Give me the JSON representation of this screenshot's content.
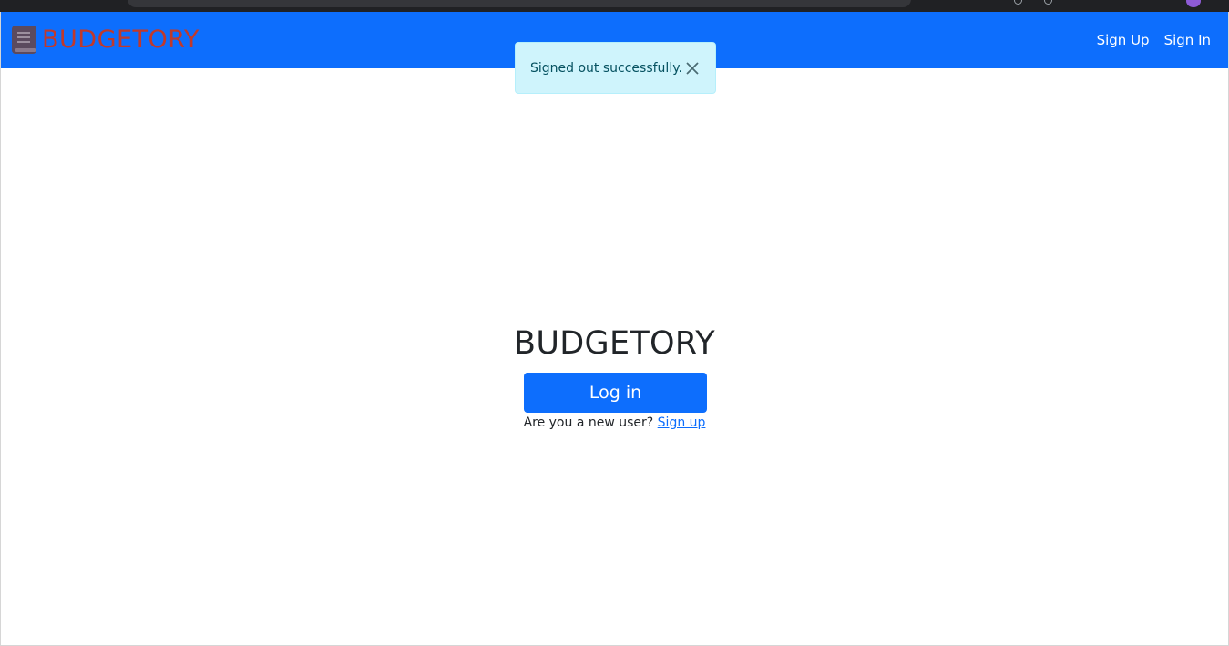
{
  "brand": {
    "name": "BUDGETORY",
    "icon": "book-icon",
    "text_color": "#c0392b",
    "icon_color": "#5b4a5e"
  },
  "navbar": {
    "background": "#0d6efd",
    "links": [
      {
        "label": "Sign Up"
      },
      {
        "label": "Sign In"
      }
    ]
  },
  "flash": {
    "message": "Signed out successfully.",
    "close_icon": "close-icon",
    "background": "#cff4fc"
  },
  "main": {
    "title": "BUDGETORY",
    "login_label": "Log in",
    "signup_prompt": "Are you a new user?",
    "signup_link": "Sign up"
  }
}
